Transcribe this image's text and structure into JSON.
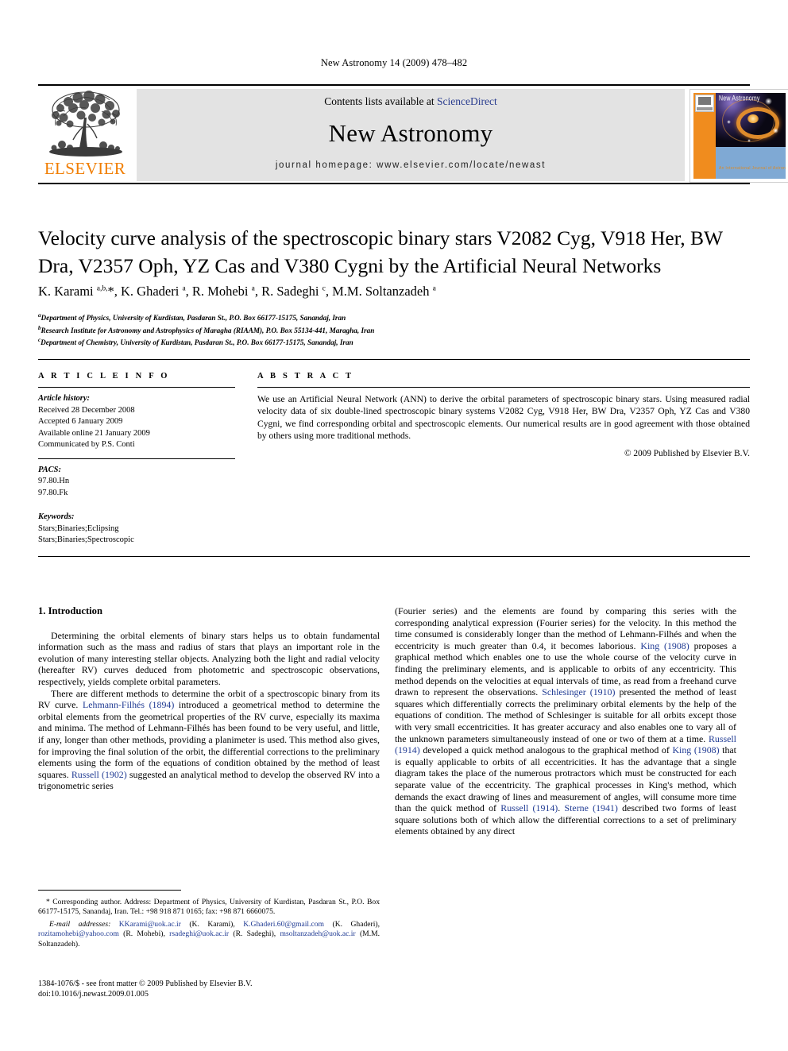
{
  "running_head": "New Astronomy 14 (2009) 478–482",
  "masthead": {
    "publisher_logo_label": "ELSEVIER",
    "contents_prefix": "Contents lists available at ",
    "contents_link": "ScienceDirect",
    "journal_title": "New Astronomy",
    "journal_homepage": "journal homepage: www.elsevier.com/locate/newast",
    "cover": {
      "title": "New Astronomy",
      "subtitle": "An International Journal of Astronomy and Astrophysics"
    }
  },
  "article": {
    "title": "Velocity curve analysis of the spectroscopic binary stars V2082 Cyg, V918 Her, BW Dra, V2357 Oph, YZ Cas and V380 Cygni by the Artificial Neural Networks",
    "authors_html": "K. Karami <sup>a,b,</sup>*, K. Ghaderi <sup>a</sup>, R. Mohebi <sup>a</sup>, R. Sadeghi <sup>c</sup>, M.M. Soltanzadeh <sup>a</sup>",
    "affiliations": [
      {
        "marker": "a",
        "text": "Department of Physics, University of Kurdistan, Pasdaran St., P.O. Box 66177-15175, Sanandaj, Iran"
      },
      {
        "marker": "b",
        "text": "Research Institute for Astronomy and Astrophysics of Maragha (RIAAM), P.O. Box 55134-441, Maragha, Iran"
      },
      {
        "marker": "c",
        "text": "Department of Chemistry, University of Kurdistan, Pasdaran St., P.O. Box 66177-15175, Sanandaj, Iran"
      }
    ]
  },
  "article_info": {
    "heading": "A R T I C L E    I N F O",
    "history_label": "Article history:",
    "history": [
      "Received 28 December 2008",
      "Accepted 6 January 2009",
      "Available online 21 January 2009",
      "Communicated by P.S. Conti"
    ],
    "pacs_label": "PACS:",
    "pacs": [
      "97.80.Hn",
      "97.80.Fk"
    ],
    "keywords_label": "Keywords:",
    "keywords": [
      "Stars;Binaries;Eclipsing",
      "Stars;Binaries;Spectroscopic"
    ]
  },
  "abstract": {
    "heading": "A B S T R A C T",
    "text": "We use an Artificial Neural Network (ANN) to derive the orbital parameters of spectroscopic binary stars. Using measured radial velocity data of six double-lined spectroscopic binary systems V2082 Cyg, V918 Her, BW Dra, V2357 Oph, YZ Cas and V380 Cygni, we find corresponding orbital and spectroscopic elements. Our numerical results are in good agreement with those obtained by others using more traditional methods.",
    "copyright": "© 2009 Published by Elsevier B.V."
  },
  "body": {
    "section_heading": "1. Introduction",
    "left_paragraphs": [
      "Determining the orbital elements of binary stars helps us to obtain fundamental information such as the mass and radius of stars that plays an important role in the evolution of many interesting stellar objects. Analyzing both the light and radial velocity (hereafter RV) curves deduced from photometric and spectroscopic observations, respectively, yields complete orbital parameters."
    ],
    "left_p2_parts": {
      "a": "There are different methods to determine the orbit of a spectroscopic binary from its RV curve. ",
      "ref1": "Lehmann-Filhés (1894)",
      "b": " introduced a geometrical method to determine the orbital elements from the geometrical properties of the RV curve, especially its maxima and minima. The method of Lehmann-Filhés has been found to be very useful, and little, if any, longer than other methods, providing a planimeter is used. This method also gives, for improving the final solution of the orbit, the differential corrections to the preliminary elements using the form of the equations of condition obtained by the method of least squares. ",
      "ref2": "Russell (1902)",
      "c": " suggested an analytical method to develop the observed RV into a trigonometric series"
    },
    "right_parts": {
      "a": "(Fourier series) and the elements are found by comparing this series with the corresponding analytical expression (Fourier series) for the velocity. In this method the time consumed is considerably longer than the method of Lehmann-Filhés and when the eccentricity is much greater than 0.4, it becomes laborious. ",
      "ref1": "King (1908)",
      "b": " proposes a graphical method which enables one to use the whole course of the velocity curve in finding the preliminary elements, and is applicable to orbits of any eccentricity. This method depends on the velocities at equal intervals of time, as read from a freehand curve drawn to represent the observations. ",
      "ref2": "Schlesinger (1910)",
      "c": " presented the method of least squares which differentially corrects the preliminary orbital elements by the help of the equations of condition. The method of Schlesinger is suitable for all orbits except those with very small eccentricities. It has greater accuracy and also enables one to vary all of the unknown parameters simultaneously instead of one or two of them at a time. ",
      "ref3": "Russell (1914)",
      "d": " developed a quick method analogous to the graphical method of ",
      "ref4": "King (1908)",
      "e": " that is equally applicable to orbits of all eccentricities. It has the advantage that a single diagram takes the place of the numerous protractors which must be constructed for each separate value of the eccentricity. The graphical processes in King's method, which demands the exact drawing of lines and measurement of angles, will consume more time than the quick method of ",
      "ref5": "Russell (1914)",
      "f": ". ",
      "ref6": "Sterne (1941)",
      "g": " described two forms of least square solutions both of which allow the differential corrections to a set of preliminary elements obtained by any direct"
    }
  },
  "footnotes": {
    "corresponding": "* Corresponding author. Address: Department of Physics, University of Kurdistan, Pasdaran St., P.O. Box 66177-15175, Sanandaj, Iran. Tel.: +98 918 871 0165; fax: +98 871 6660075.",
    "email_label": "E-mail addresses:",
    "emails": [
      {
        "address": "KKarami@uok.ac.ir",
        "owner": "(K. Karami)"
      },
      {
        "address": "K.Ghaderi.60@gmail.com",
        "owner": "(K. Ghaderi)"
      },
      {
        "address": "rozitamohebi@yahoo.com",
        "owner": "(R. Mohebi)"
      },
      {
        "address": "rsadeghi@uok.ac.ir",
        "owner": "(R. Sadeghi)"
      },
      {
        "address": "msoltanzadeh@uok.ac.ir",
        "owner": "(M.M. Soltanzadeh)"
      }
    ]
  },
  "imprint": {
    "line1": "1384-1076/$ - see front matter © 2009 Published by Elsevier B.V.",
    "line2": "doi:10.1016/j.newast.2009.01.005"
  },
  "colors": {
    "link": "#2a3d8f",
    "reference": "#1f3a93",
    "elsevier_orange": "#F07D00",
    "masthead_gray": "#e3e3e3"
  }
}
